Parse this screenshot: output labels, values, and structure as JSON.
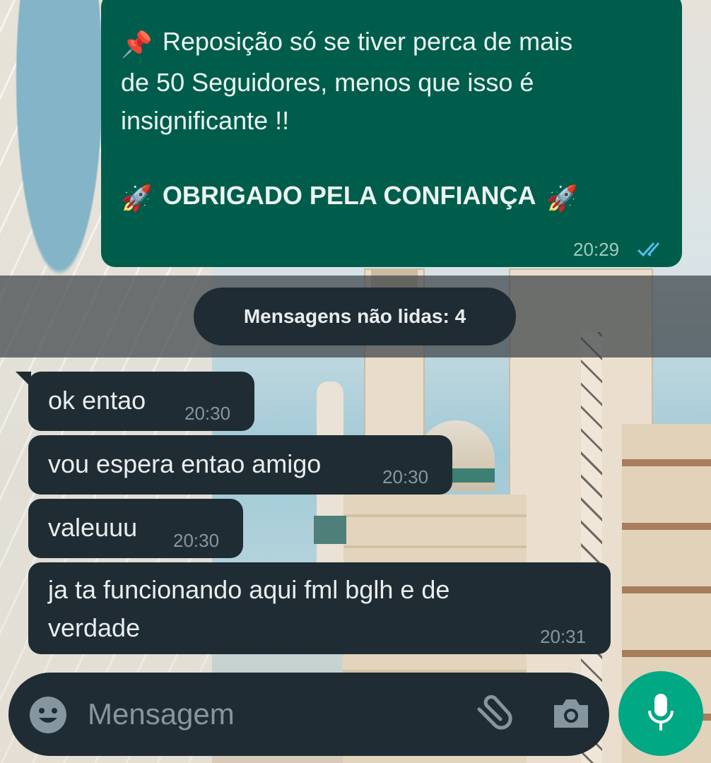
{
  "chat": {
    "outgoing_message": {
      "pin_emoji": "📌",
      "text": "Reposição só se tiver perca de mais\nde 50 Seguidores, menos que isso é\ninsignificante !!",
      "rocket_left": "🚀",
      "bold_text": "OBRIGADO PELA CONFIANÇA",
      "rocket_right": "🚀",
      "time": "20:29",
      "status_icon": "double-check-read-icon"
    },
    "unread_banner": "Mensagens não lidas: 4",
    "incoming_messages": [
      {
        "text": "ok entao",
        "time": "20:30"
      },
      {
        "text": "vou espera entao amigo",
        "time": "20:30"
      },
      {
        "text": "valeuuu",
        "time": "20:30"
      },
      {
        "text": "ja ta funcionando aqui fml bglh e de\nverdade",
        "time": "20:31"
      }
    ]
  },
  "composer": {
    "placeholder": "Mensagem",
    "emoji_icon": "emoji-icon",
    "attach_icon": "paperclip-icon",
    "camera_icon": "camera-icon",
    "mic_icon": "microphone-icon"
  },
  "colors": {
    "outgoing_bubble": "#005d4b",
    "incoming_bubble": "#1f2c33",
    "mic_button": "#00a884",
    "read_ticks": "#53bdeb"
  }
}
